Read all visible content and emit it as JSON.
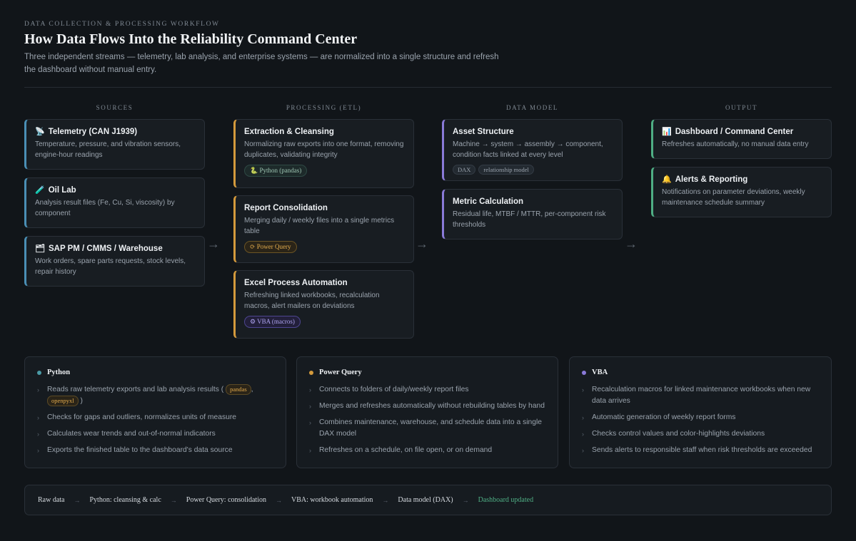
{
  "header": {
    "eyebrow": "DATA COLLECTION & PROCESSING WORKFLOW",
    "title": "How Data Flows Into the Reliability Command Center",
    "subtitle": "Three independent streams — telemetry, lab analysis, and enterprise systems — are normalized into a single structure and refresh the dashboard without manual entry."
  },
  "columns": {
    "sources": "SOURCES",
    "processing": "PROCESSING (ETL)",
    "model": "DATA MODEL",
    "output": "OUTPUT"
  },
  "sources": [
    {
      "icon": "satellite-dish-icon",
      "glyph": "📡",
      "title": "Telemetry (CAN J1939)",
      "desc": "Temperature, pressure, and vibration sensors, engine-hour readings"
    },
    {
      "icon": "test-tube-icon",
      "glyph": "🧪",
      "title": "Oil Lab",
      "desc": "Analysis result files (Fe, Cu, Si, viscosity) by component"
    },
    {
      "icon": "card-index-dividers-icon",
      "glyph": "🗂",
      "title": "SAP PM / CMMS / Warehouse",
      "desc": "Work orders, spare parts requests, stock levels, repair history"
    }
  ],
  "processing": [
    {
      "title": "Extraction & Cleansing",
      "desc": "Normalizing raw exports into one format, removing duplicates, validating integrity",
      "pill": "🐍 Python (pandas)"
    },
    {
      "title": "Report Consolidation",
      "desc": "Merging daily / weekly files into a single metrics table",
      "pill": "⟳ Power Query"
    },
    {
      "title": "Excel Process Automation",
      "desc": "Refreshing linked workbooks, recalculation macros, alert mailers on deviations",
      "pill": "⚙ VBA (macros)"
    }
  ],
  "model": [
    {
      "title": "Asset Structure",
      "desc": "Machine → system → assembly → component, condition facts linked at every level",
      "tags": [
        "DAX",
        "relationship model"
      ]
    },
    {
      "title": "Metric Calculation",
      "desc": "Residual life, MTBF / MTTR, per-component risk thresholds"
    }
  ],
  "output": [
    {
      "icon": "bar-chart-icon",
      "glyph": "📊",
      "title": "Dashboard / Command Center",
      "desc": "Refreshes automatically, no manual data entry"
    },
    {
      "icon": "bell-icon",
      "glyph": "🔔",
      "title": "Alerts & Reporting",
      "desc": "Notifications on parameter deviations, weekly maintenance schedule summary"
    }
  ],
  "arrow_glyph": "→",
  "bullet_glyph": "›",
  "panels": {
    "python": {
      "title": "Python",
      "color": "#4a9aa5",
      "item0_text": "Reads raw telemetry exports and lab analysis results (",
      "item0_code1": "pandas",
      "item0_sep": ",",
      "item0_code2": "openpyxl",
      "item0_end": ")",
      "items": [
        "Checks for gaps and outliers, normalizes units of measure",
        "Calculates wear trends and out-of-normal indicators",
        "Exports the finished table to the dashboard's data source"
      ]
    },
    "powerquery": {
      "title": "Power Query",
      "color": "#d49a3c",
      "items": [
        "Connects to folders of daily/weekly report files",
        "Merges and refreshes automatically without rebuilding tables by hand",
        "Combines maintenance, warehouse, and schedule data into a single DAX model",
        "Refreshes on a schedule, on file open, or on demand"
      ]
    },
    "vba": {
      "title": "VBA",
      "color": "#8a7ad8",
      "items": [
        "Recalculation macros for linked maintenance workbooks when new data arrives",
        "Automatic generation of weekly report forms",
        "Checks control values and color-highlights deviations",
        "Sends alerts to responsible staff when risk thresholds are exceeded"
      ]
    }
  },
  "flow": {
    "steps": [
      "Raw data",
      "Python: cleansing & calc",
      "Power Query: consolidation",
      "VBA: workbook automation",
      "Data model (DAX)"
    ],
    "final": "Dashboard updated",
    "sep": "→"
  }
}
